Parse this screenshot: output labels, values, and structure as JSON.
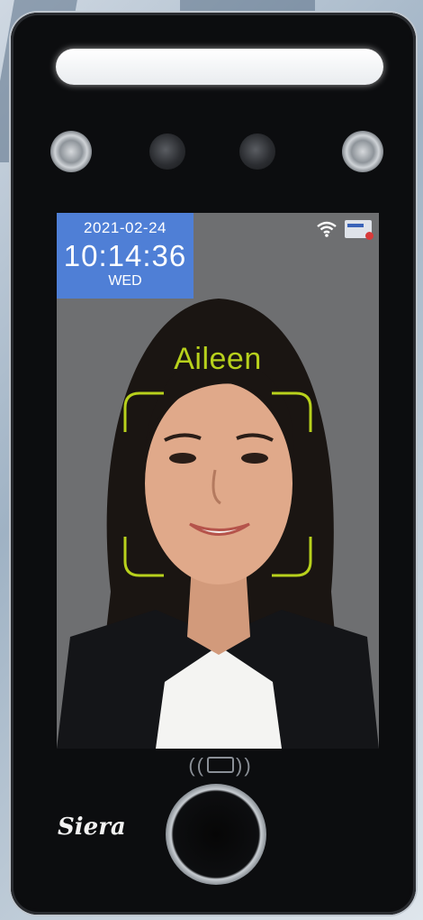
{
  "screen": {
    "date": "2021-02-24",
    "time": "10:14:36",
    "weekday": "WED",
    "recognized_name": "Aileen"
  },
  "device": {
    "brand": "Siera"
  },
  "icons": {
    "wifi": "wifi-icon",
    "card": "id-card-icon",
    "rfid": "rfid-reader-icon",
    "fingerprint": "fingerprint-sensor-icon"
  },
  "colors": {
    "clock_bg": "#4f7fd6",
    "face_frame": "#b8d11c",
    "device_body": "#0c0d0f"
  }
}
